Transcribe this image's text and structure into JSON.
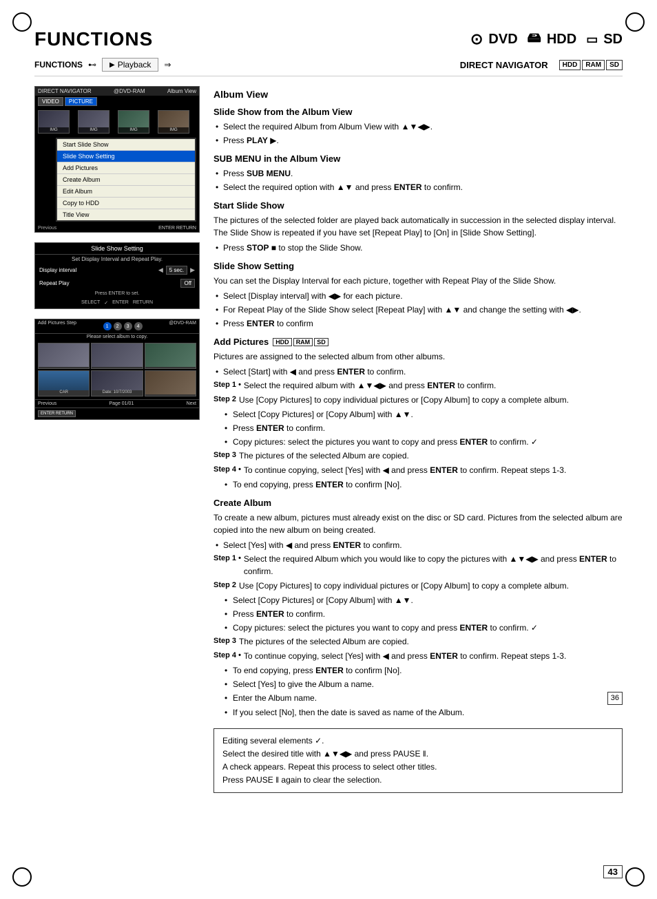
{
  "page": {
    "title": "FUNCTIONS",
    "media_labels": [
      "DVD",
      "HDD",
      "SD"
    ],
    "page_number": "43",
    "nav": {
      "functions_label": "FUNCTIONS",
      "playback_label": "Playback",
      "direct_navigator_label": "DIRECT NAVIGATOR",
      "badges": [
        "HDD",
        "RAM",
        "SD"
      ]
    }
  },
  "left_panels": {
    "album_panel": {
      "header_left": "DIRECT NAVIGATOR",
      "header_right": "Album View",
      "dvd_label": "@DVD-RAM",
      "tabs": [
        "VIDEO",
        "PICTURE"
      ],
      "active_tab": "PICTURE",
      "thumbs": [
        {
          "label": ""
        },
        {
          "label": ""
        },
        {
          "label": ""
        },
        {
          "label": ""
        }
      ],
      "menu_items": [
        {
          "label": "Start Slide Show",
          "highlighted": false
        },
        {
          "label": "Slide Show Setting",
          "highlighted": true
        },
        {
          "label": "Add Pictures",
          "highlighted": false
        },
        {
          "label": "Create Album",
          "highlighted": false
        },
        {
          "label": "Edit Album",
          "highlighted": false
        },
        {
          "label": "Copy to HDD",
          "highlighted": false
        },
        {
          "label": "Title View",
          "highlighted": false
        }
      ],
      "nav_labels": [
        "Previous"
      ],
      "enter_return": "ENTER RETURN"
    },
    "setting_panel": {
      "title": "Slide Show Setting",
      "subtitle": "Set Display Interval and Repeat Play.",
      "rows": [
        {
          "label": "Display interval",
          "value": "5 sec."
        },
        {
          "label": "Repeat Play",
          "value": "Off"
        }
      ],
      "hint": "Press ENTER to set.",
      "buttons": [
        "SELECT",
        "ENTER",
        "RETURN"
      ]
    },
    "add_pictures_panel": {
      "header_left": "Add Pictures  Step",
      "steps": [
        "1",
        "2",
        "3",
        "4"
      ],
      "active_step": "1",
      "dvd_label": "@DVD-RAM",
      "subtitle": "Please select album to copy.",
      "thumbs": [
        {
          "label": "",
          "type": "img"
        },
        {
          "label": "",
          "type": "img"
        },
        {
          "label": "",
          "type": "img"
        },
        {
          "label": "CAR",
          "type": "car"
        },
        {
          "label": "Date: 10/7/2003",
          "type": "date"
        },
        {
          "label": "",
          "type": "img"
        }
      ],
      "nav": {
        "prev": "Previous",
        "page": "Page 01/01",
        "next": "Next"
      },
      "enter_return": "ENTER RETURN"
    }
  },
  "content": {
    "album_view_title": "Album View",
    "sections": [
      {
        "id": "slide_show_album_view",
        "title": "Slide Show from the Album View",
        "bullets": [
          "Select the required Album from Album View with ▲▼◀▶.",
          "Press PLAY ▶."
        ]
      },
      {
        "id": "sub_menu_album_view",
        "title": "SUB MENU in the Album View",
        "bullets": [
          "Press SUB MENU.",
          "Select the required option with ▲▼ and press ENTER to confirm."
        ]
      },
      {
        "id": "start_slide_show",
        "title": "Start Slide Show",
        "body": "The pictures of the selected folder are played back automatically in succession in the selected display interval. The Slide Show is repeated if you have set [Repeat Play] to [On] in [Slide Show Setting].",
        "bullets": [
          "Press STOP ■ to stop the Slide Show."
        ]
      },
      {
        "id": "slide_show_setting",
        "title": "Slide Show Setting",
        "body": "You can set the Display Interval for each picture, together with Repeat Play of the Slide Show.",
        "bullets": [
          "Select [Display interval] with ◀▶ for each picture.",
          "For Repeat Play of the Slide Show select [Repeat Play] with ▲▼ and change the setting with ◀▶.",
          "Press ENTER to confirm"
        ]
      },
      {
        "id": "add_pictures",
        "title": "Add Pictures",
        "badges": [
          "HDD",
          "RAM",
          "SD"
        ],
        "body": "Pictures are assigned to the selected album from other albums.",
        "bullets_before_steps": [
          "Select [Start] with ◀ and press ENTER to confirm."
        ],
        "steps": [
          {
            "num": "1",
            "text": "Select the required album with ▲▼◀▶ and press ENTER to confirm."
          },
          {
            "num": "2",
            "text": "Use [Copy Pictures] to copy individual pictures or [Copy Album] to copy a complete album.",
            "sub_bullets": [
              "Select [Copy Pictures] or [Copy Album] with ▲▼.",
              "Press ENTER to confirm.",
              "Copy pictures: select the pictures you want to copy and press ENTER to confirm. ✓"
            ]
          },
          {
            "num": "3",
            "text": "The pictures of the selected Album are copied."
          },
          {
            "num": "4",
            "text": "To continue copying, select [Yes] with ◀ and press ENTER to confirm. Repeat steps 1-3.",
            "sub_bullets": [
              "To end copying, press ENTER to confirm [No]."
            ]
          }
        ]
      },
      {
        "id": "create_album",
        "title": "Create Album",
        "body": "To create a new album, pictures must already exist on the disc or SD card. Pictures from the selected album are copied into the new album on being created.",
        "bullets_before_steps": [
          "Select [Yes] with ◀ and press ENTER to confirm."
        ],
        "steps": [
          {
            "num": "1",
            "text": "Select the required Album which you would like to copy the pictures with ▲▼◀▶ and press ENTER to confirm."
          },
          {
            "num": "2",
            "text": "Use [Copy Pictures] to copy individual pictures or [Copy Album] to copy a complete album.",
            "sub_bullets": [
              "Select [Copy Pictures] or [Copy Album] with ▲▼.",
              "Press ENTER to confirm.",
              "Copy pictures: select the pictures you want to copy and press ENTER to confirm. ✓"
            ]
          },
          {
            "num": "3",
            "text": "The pictures of the selected Album are copied."
          },
          {
            "num": "4",
            "text": "To continue copying, select [Yes] with ◀ and press ENTER to confirm. Repeat steps 1-3.",
            "sub_bullets": [
              "To end copying, press ENTER to confirm [No].",
              "Select [Yes] to give the Album a name.",
              "Enter the Album name.",
              "If you select [No], then the date is saved as name of the Album."
            ]
          }
        ]
      }
    ],
    "note_box": {
      "lines": [
        "Editing several elements ✓.",
        "Select the desired title with ▲▼◀▶ and press PAUSE ‖.",
        "A check appears. Repeat this process to select other titles.",
        "Press PAUSE ‖ again to clear the selection."
      ]
    }
  }
}
